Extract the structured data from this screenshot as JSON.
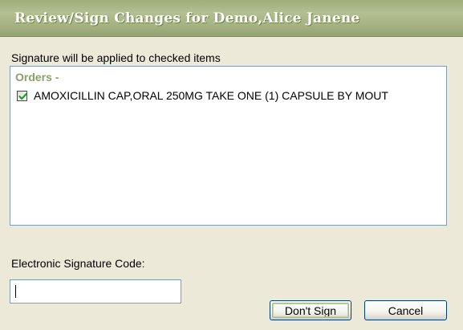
{
  "window": {
    "title": "Review/Sign Changes for Demo,Alice Janene"
  },
  "instruction": "Signature will be applied to checked items",
  "orders": {
    "group_label": "Orders -",
    "items": [
      {
        "label": "AMOXICILLIN CAP,ORAL  250MG TAKE ONE (1) CAPSULE BY MOUT",
        "checked": true
      }
    ]
  },
  "signature": {
    "label": "Electronic Signature Code:",
    "value": ""
  },
  "buttons": {
    "dont_sign": "Don't Sign",
    "cancel": "Cancel"
  },
  "colors": {
    "title_bar": "#A5B383",
    "group_label": "#8AA06A",
    "dialog_background": "#ECE9D8",
    "check_mark": "#21A121"
  }
}
